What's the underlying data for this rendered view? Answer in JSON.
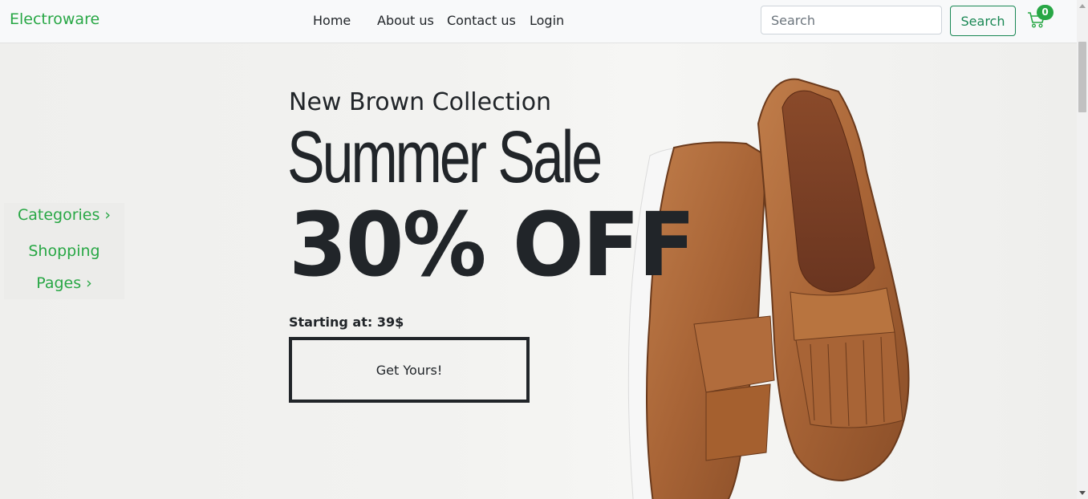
{
  "nav": {
    "brand": "Electroware",
    "links": [
      "Home",
      "About us",
      "Contact us",
      "Login"
    ],
    "search_placeholder": "Search",
    "search_button": "Search",
    "cart_count": "0",
    "accent": "#28a745"
  },
  "sidebar": {
    "items": [
      "Categories ›",
      "Shopping",
      "Pages ›"
    ]
  },
  "hero": {
    "subtitle": "New Brown Collection",
    "title": "Summer Sale",
    "discount": "30% OFF",
    "price": "Starting at: 39$",
    "cta": "Get Yours!"
  },
  "icons": [
    "cart-icon",
    "shoes-image"
  ]
}
